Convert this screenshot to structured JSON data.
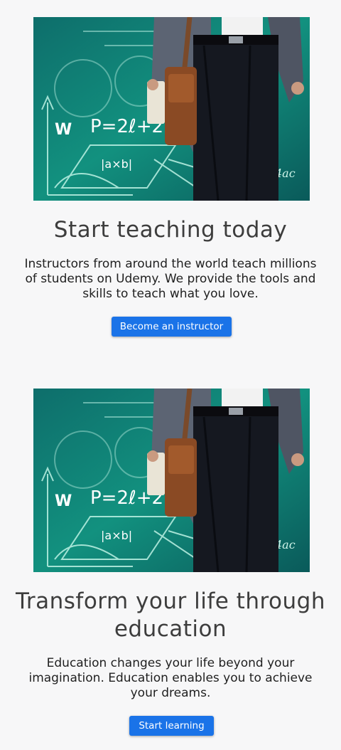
{
  "sections": [
    {
      "title": "Start teaching today",
      "description": "Instructors from around the world teach millions of students on Udemy. We provide the tools and skills to teach what you love.",
      "button_label": "Become an instructor",
      "image_icon": "teacher-chalkboard-image"
    },
    {
      "title": "Transform your life through education",
      "description": "Education changes your life beyond your imagination. Education enables you to achieve your dreams.",
      "button_label": "Start learning",
      "image_icon": "teacher-chalkboard-image"
    }
  ],
  "board_formula": "P=2ℓ+2w",
  "colors": {
    "button": "#1a73e8",
    "background": "#f7f7f8",
    "board": "#0f7f77"
  }
}
